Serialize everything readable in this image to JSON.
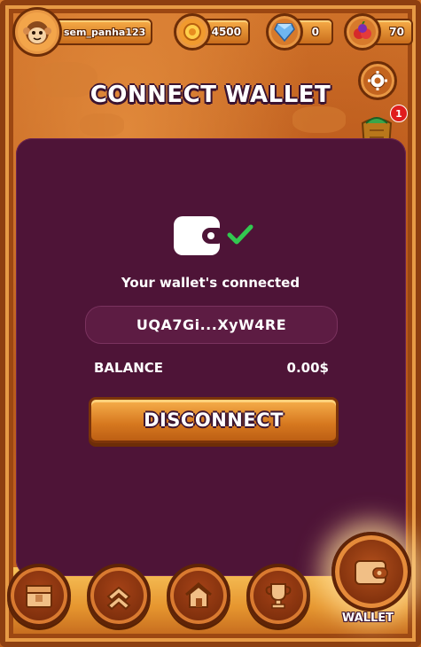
{
  "header": {
    "username": "sem_panha123",
    "coins": "4500",
    "gems": "0",
    "fruits": "70"
  },
  "page": {
    "title": "CONNECT WALLET"
  },
  "wallet": {
    "status_text": "Your wallet's connected",
    "address": "UQA7Gi...XyW4RE",
    "balance_label": "BALANCE",
    "balance_value": "0.00$",
    "disconnect_label": "DISCONNECT"
  },
  "side": {
    "gift_badge": "1"
  },
  "nav": {
    "active_label": "WALLET",
    "items": [
      "inventory",
      "upgrade",
      "home",
      "leaderboard",
      "wallet"
    ]
  },
  "colors": {
    "panel": "#4e1437",
    "frame": "#c8641f",
    "button": "#d6781f"
  }
}
